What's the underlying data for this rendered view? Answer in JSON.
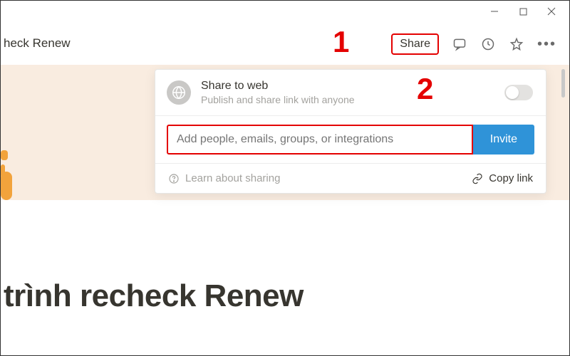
{
  "window": {
    "title": "heck Renew"
  },
  "topbar": {
    "share_label": "Share"
  },
  "page": {
    "title_fragment": "trình recheck Renew"
  },
  "share_panel": {
    "title": "Share to web",
    "subtitle": "Publish and share link with anyone",
    "invite_placeholder": "Add people, emails, groups, or integrations",
    "invite_button": "Invite",
    "learn_label": "Learn about sharing",
    "copy_label": "Copy link"
  },
  "annotations": {
    "one": "1",
    "two": "2"
  }
}
